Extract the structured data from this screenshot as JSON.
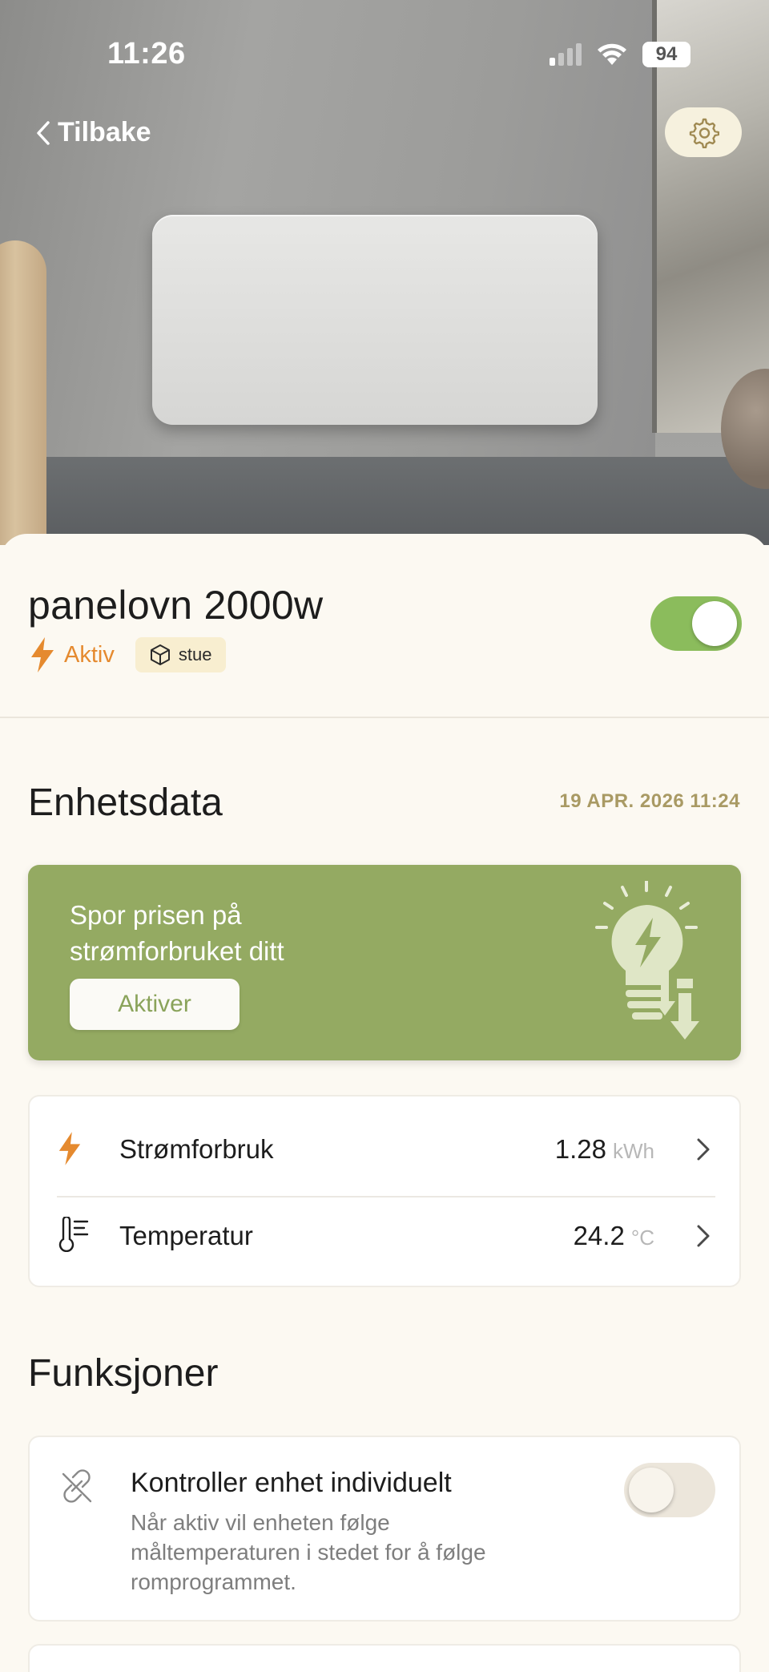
{
  "status_bar": {
    "time": "11:26",
    "battery": "94",
    "signal_bars": 1,
    "wifi": "wifi-icon"
  },
  "nav": {
    "back_label": "Tilbake",
    "settings_icon": "gear-icon"
  },
  "device": {
    "name": "panelovn 2000w",
    "status": "Aktiv",
    "room": "stue",
    "power_on": true
  },
  "device_data": {
    "title": "Enhetsdata",
    "timestamp": "19 APR. 2026 11:24",
    "promo": {
      "text": "Spor prisen på strømforbruket ditt",
      "button": "Aktiver"
    },
    "metrics": [
      {
        "label": "Strømforbruk",
        "value": "1.28",
        "unit": "kWh",
        "icon": "lightning-icon"
      },
      {
        "label": "Temperatur",
        "value": "24.2",
        "unit": "°C",
        "icon": "thermometer-icon"
      }
    ]
  },
  "functions": {
    "title": "Funksjoner",
    "items": [
      {
        "title": "Kontroller enhet individuelt",
        "description": "Når aktiv vil enheten følge måltemperaturen i stedet for å følge romprogrammet.",
        "enabled": false,
        "icon": "unlink-icon"
      }
    ]
  },
  "colors": {
    "accent_orange": "#e58a2f",
    "promo_green": "#94aa62",
    "toggle_on": "#8bbc5c",
    "timestamp_gold": "#a99a64"
  }
}
